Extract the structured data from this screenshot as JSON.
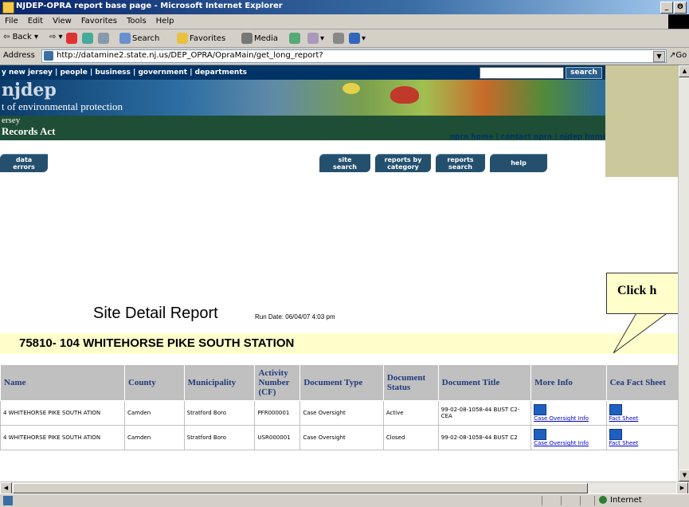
{
  "window": {
    "title": "NJDEP-OPRA report base page - Microsoft Internet Explorer",
    "controls": [
      "_",
      "Θ",
      "×"
    ]
  },
  "menu": [
    "File",
    "Edit",
    "View",
    "Favorites",
    "Tools",
    "Help"
  ],
  "toolbar": {
    "back": "Back",
    "search": "Search",
    "favorites": "Favorites",
    "media": "Media"
  },
  "address": {
    "label": "Address",
    "url": "http://datamine2.state.nj.us/DEP_OPRA/OpraMain/get_long_report?",
    "go": "Go"
  },
  "site": {
    "topnav": "y new jersey  |  people  |  business  |  government  |  departments",
    "search_button": "search",
    "logo_text": "njdep",
    "dept_text": "t of environmental protection",
    "sub_line1": "ersey",
    "sub_line2": "Records Act",
    "links": "opra home  |  contact opra  |  njdep home"
  },
  "nav_buttons": [
    {
      "l1": "data",
      "l2": "errors"
    },
    {
      "l1": "site",
      "l2": "search"
    },
    {
      "l1": "reports by",
      "l2": "category"
    },
    {
      "l1": "reports",
      "l2": "search"
    },
    {
      "l1": "help",
      "l2": ""
    }
  ],
  "report": {
    "title": "Site Detail Report",
    "run_date": "Run Date: 06/04/07 4:03 pm",
    "site_heading": "75810- 104 WHITEHORSE PIKE SOUTH STATION"
  },
  "callout": {
    "text": "Click h"
  },
  "table": {
    "headers": [
      "Name",
      "County",
      "Municipality",
      "Activity Number (CF)",
      "Document Type",
      "Document Status",
      "Document Title",
      "More Info",
      "Cea Fact Sheet"
    ],
    "rows": [
      {
        "name": "4 WHITEHORSE PIKE SOUTH ATION",
        "county": "Camden",
        "municipality": "Stratford Boro",
        "activity": "PFR000001",
        "doc_type": "Case Oversight",
        "status": "Active",
        "title": "99-02-08-1058-44 BUST  C2-CEA",
        "more_info": "Case Oversight Info",
        "fact_sheet": "Fact Sheet"
      },
      {
        "name": "4 WHITEHORSE PIKE SOUTH ATION",
        "county": "Camden",
        "municipality": "Stratford Boro",
        "activity": "USR000001",
        "doc_type": "Case Oversight",
        "status": "Closed",
        "title": "99-02-08-1058-44 BUST  C2",
        "more_info": "Case Oversight Info",
        "fact_sheet": "Fact Sheet"
      }
    ]
  },
  "status": {
    "zone": "Internet"
  }
}
